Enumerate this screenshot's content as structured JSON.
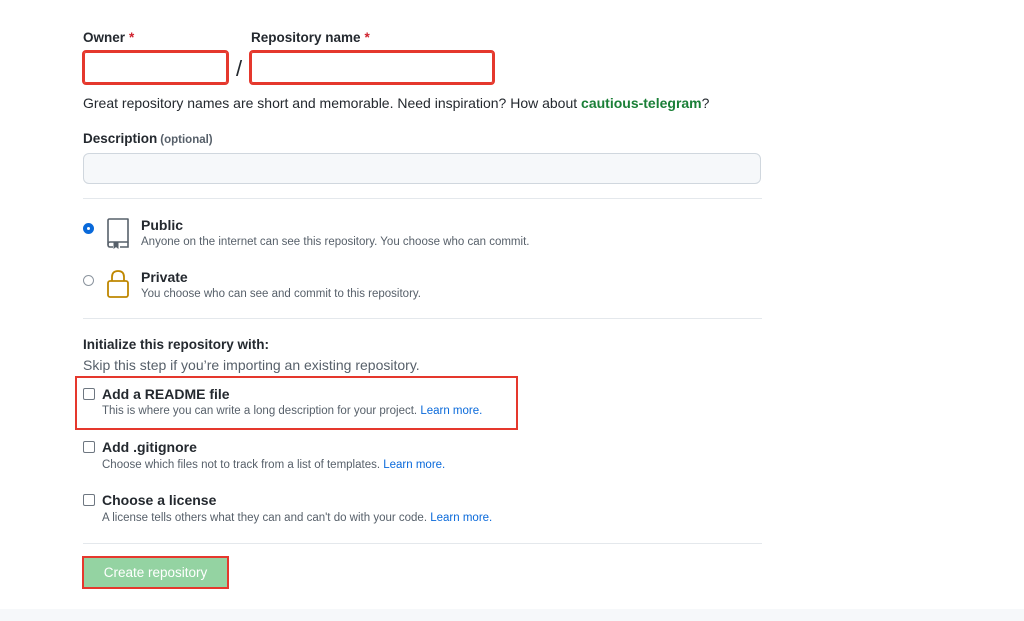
{
  "owner": {
    "label": "Owner",
    "required_mark": "*",
    "value": ""
  },
  "repository": {
    "label": "Repository name",
    "required_mark": "*",
    "value": "",
    "separator": "/"
  },
  "hint": {
    "prefix": "Great repository names are short and memorable. Need inspiration? How about ",
    "suggestion": "cautious-telegram",
    "suffix": "?"
  },
  "description": {
    "label": "Description",
    "optional": "(optional)",
    "value": ""
  },
  "visibility": {
    "public": {
      "title": "Public",
      "desc": "Anyone on the internet can see this repository. You choose who can commit.",
      "checked": true
    },
    "private": {
      "title": "Private",
      "desc": "You choose who can see and commit to this repository.",
      "checked": false
    }
  },
  "init": {
    "title": "Initialize this repository with:",
    "subtitle": "Skip this step if you’re importing an existing repository.",
    "readme": {
      "title": "Add a README file",
      "desc": "This is where you can write a long description for your project.",
      "link": "Learn more."
    },
    "gitignore": {
      "title": "Add .gitignore",
      "desc": "Choose which files not to track from a list of templates.",
      "link": "Learn more."
    },
    "license": {
      "title": "Choose a license",
      "desc": "A license tells others what they can and can't do with your code.",
      "link": "Learn more."
    }
  },
  "submit": {
    "label": "Create repository"
  },
  "colors": {
    "highlight": "#e5382d",
    "suggestion": "#1a7f37",
    "link": "#0969da",
    "button_disabled": "#94d3a2",
    "public_icon": "#57606a",
    "private_icon": "#bf8700"
  }
}
